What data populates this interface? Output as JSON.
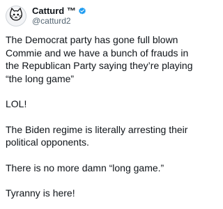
{
  "tweet": {
    "author": {
      "display_name": "Catturd ™",
      "handle": "@catturd2",
      "verified_icon": "verified-badge-icon",
      "avatar_icon": "cat-avatar-icon"
    },
    "paragraphs": [
      "The Democrat party has gone full blown Commie and we have a bunch of frauds in the Republican Party saying they’re playing “the long game”",
      "LOL!",
      "The Biden regime is literally arresting their political opponents.",
      "There is no more damn “long game.”",
      "Tyranny is here!"
    ]
  },
  "colors": {
    "text": "#0f1419",
    "secondary_text": "#536471",
    "verified_blue": "#1d9bf0",
    "background": "#ffffff"
  }
}
